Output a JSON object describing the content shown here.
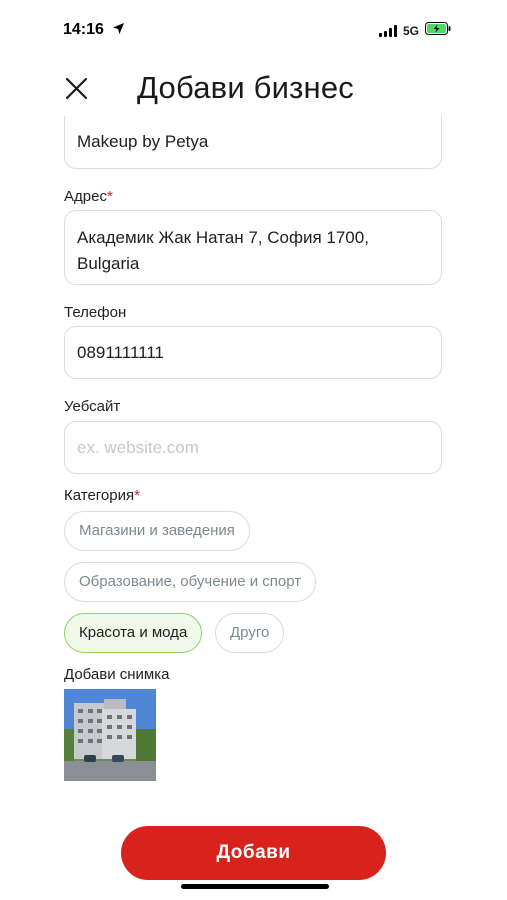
{
  "status_bar": {
    "time": "14:16",
    "network": "5G"
  },
  "header": {
    "title": "Добави бизнес"
  },
  "form": {
    "name_value": "Makeup by Petya",
    "address_label": "Адрес",
    "address_value_line1": "Академик Жак Натан 7, София 1700,",
    "address_value_line2": "Bulgaria",
    "phone_label": "Телефон",
    "phone_value": "0891111111",
    "website_label": "Уебсайт",
    "website_placeholder": "ex. website.com",
    "category_label": "Категория",
    "required_mark": "*",
    "categories": [
      {
        "label": "Магазини и заведения",
        "selected": false
      },
      {
        "label": "Образование, обучение и спорт",
        "selected": false
      },
      {
        "label": "Красота и мода",
        "selected": true
      },
      {
        "label": "Друго",
        "selected": false
      }
    ],
    "photo_label": "Добави снимка"
  },
  "actions": {
    "submit_label": "Добави"
  },
  "colors": {
    "accent": "#d8231d",
    "selected_chip_border": "#8fd16a",
    "required": "#d4232c"
  }
}
